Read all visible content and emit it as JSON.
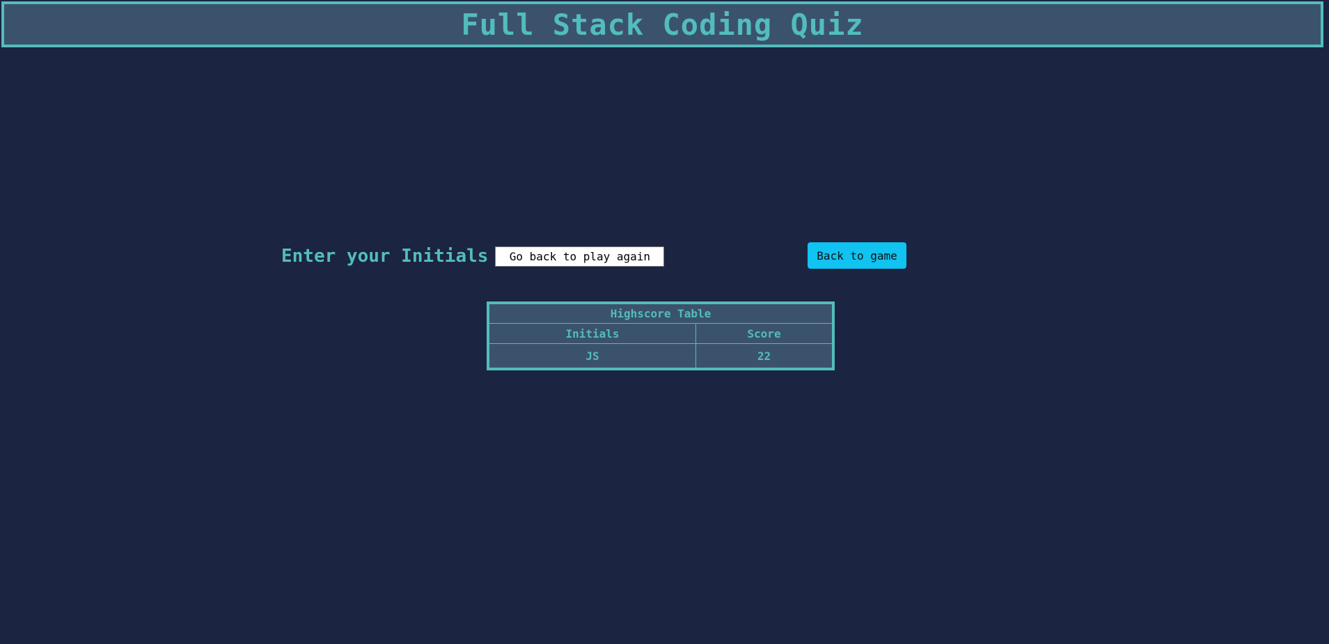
{
  "header": {
    "title": "Full Stack Coding Quiz"
  },
  "initials_form": {
    "label": "Enter your Initials",
    "input_value": "Go back to play again"
  },
  "back_button": {
    "label": "Back to game"
  },
  "highscore_table": {
    "title": "Highscore Table",
    "columns": [
      "Initials",
      "Score"
    ],
    "rows": [
      {
        "initials": "JS",
        "score": "22"
      }
    ]
  },
  "colors": {
    "background": "#1b2441",
    "panel": "#3b526d",
    "accent": "#52bdbd",
    "button": "#10c3f1"
  }
}
